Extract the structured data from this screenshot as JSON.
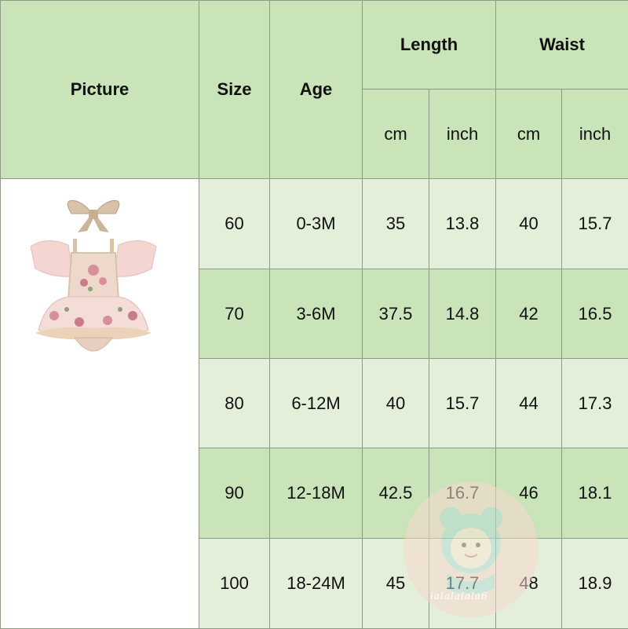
{
  "header": {
    "picture": "Picture",
    "size": "Size",
    "age": "Age",
    "length": "Length",
    "waist": "Waist",
    "length_cm": "cm",
    "length_inch": "inch",
    "waist_cm": "cm",
    "waist_inch": "inch"
  },
  "rows": [
    {
      "size": "60",
      "age": "0-3M",
      "length_cm": "35",
      "length_inch": "13.8",
      "waist_cm": "40",
      "waist_inch": "15.7"
    },
    {
      "size": "70",
      "age": "3-6M",
      "length_cm": "37.5",
      "length_inch": "14.8",
      "waist_cm": "42",
      "waist_inch": "16.5"
    },
    {
      "size": "80",
      "age": "6-12M",
      "length_cm": "40",
      "length_inch": "15.7",
      "waist_cm": "44",
      "waist_inch": "17.3"
    },
    {
      "size": "90",
      "age": "12-18M",
      "length_cm": "42.5",
      "length_inch": "16.7",
      "waist_cm": "46",
      "waist_inch": "18.1"
    },
    {
      "size": "100",
      "age": "18-24M",
      "length_cm": "45",
      "length_inch": "17.7",
      "waist_cm": "48",
      "waist_inch": "18.9"
    }
  ],
  "watermark": {
    "text": "lalalalala6"
  },
  "colors": {
    "header_green": "#c9e4b8",
    "light_green": "#e3efd9",
    "dress_pink": "#f3d6d2"
  }
}
